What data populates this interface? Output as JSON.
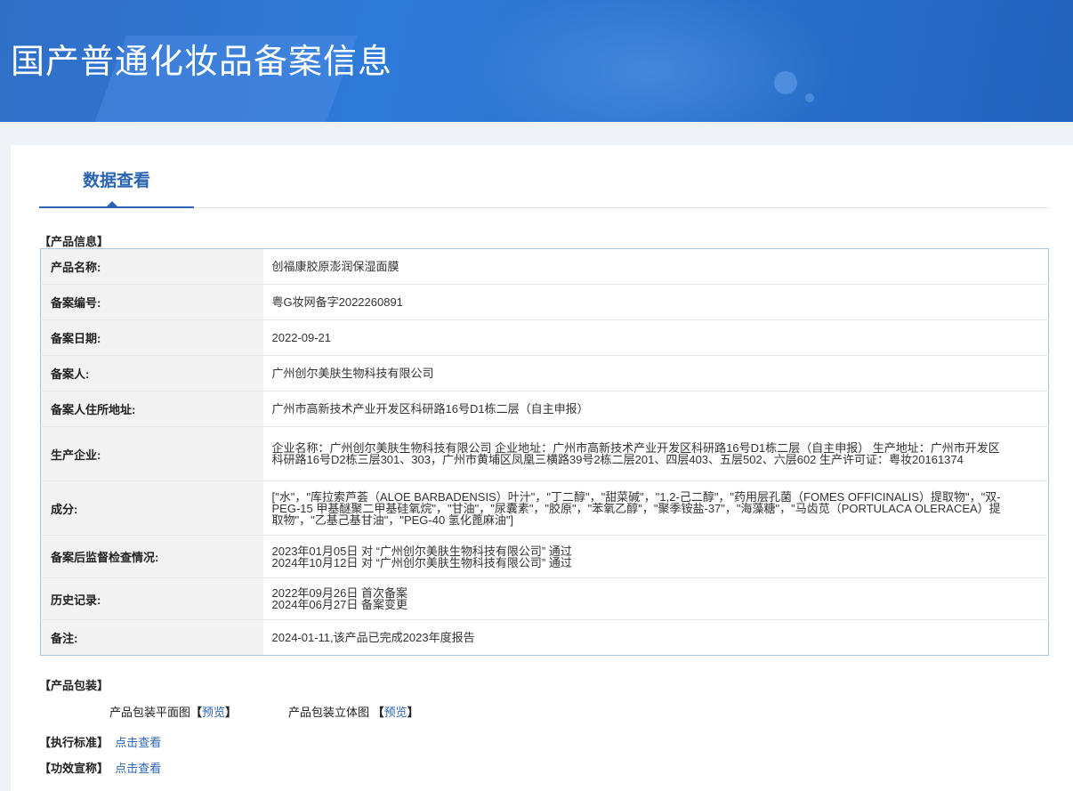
{
  "banner": {
    "title": "国产普通化妆品备案信息"
  },
  "tabs": {
    "active_label": "数据查看"
  },
  "product_info": {
    "section_title": "【产品信息】",
    "rows": [
      {
        "label": "产品名称:",
        "value": "创福康胶原澎润保湿面膜"
      },
      {
        "label": "备案编号:",
        "value": "粤G妆网备字2022260891"
      },
      {
        "label": "备案日期:",
        "value": "2022-09-21"
      },
      {
        "label": "备案人:",
        "value": "广州创尔美肤生物科技有限公司"
      },
      {
        "label": "备案人住所地址:",
        "value": "广州市高新技术产业开发区科研路16号D1栋二层（自主申报）"
      },
      {
        "label": "生产企业:",
        "value": "企业名称：广州创尔美肤生物科技有限公司 企业地址：广州市高新技术产业开发区科研路16号D1栋二层（自主申报） 生产地址：广州市开发区科研路16号D2栋三层301、303，广州市黄埔区凤凰三横路39号2栋二层201、四层403、五层502、六层602 生产许可证：粤妆20161374"
      },
      {
        "label": "成分:",
        "value": "[\"水\"，\"库拉索芦荟（ALOE BARBADENSIS）叶汁\"，\"丁二醇\"，\"甜菜碱\"，\"1,2-己二醇\"，\"药用层孔菌（FOMES OFFICINALIS）提取物\"，\"双-PEG-15 甲基醚聚二甲基硅氧烷\"，\"甘油\"，\"尿囊素\"，\"胶原\"，\"苯氧乙醇\"，\"聚季铵盐-37\"，\"海藻糖\"，\"马齿苋（PORTULACA OLERACEA）提取物\"，\"乙基己基甘油\"，\"PEG-40 氢化蓖麻油\"]"
      },
      {
        "label": "备案后监督检查情况:",
        "lines": [
          "2023年01月05日 对 “广州创尔美肤生物科技有限公司” 通过",
          "2024年10月12日 对 “广州创尔美肤生物科技有限公司” 通过"
        ]
      },
      {
        "label": "历史记录:",
        "lines": [
          "2022年09月26日 首次备案",
          "2024年06月27日 备案变更"
        ]
      },
      {
        "label": "备注:",
        "value": "2024-01-11,该产品已完成2023年度报告"
      }
    ]
  },
  "packaging": {
    "section_title": "【产品包装】",
    "flat_label": "产品包装平面图",
    "flat_link": "预览",
    "three_d_label": "产品包装立体图",
    "three_d_link": "预览",
    "open_bracket": "【",
    "close_bracket": "】"
  },
  "standard": {
    "section_title": "【执行标准】",
    "link": "点击查看"
  },
  "efficacy": {
    "section_title": "【功效宣称】",
    "link": "点击查看"
  }
}
